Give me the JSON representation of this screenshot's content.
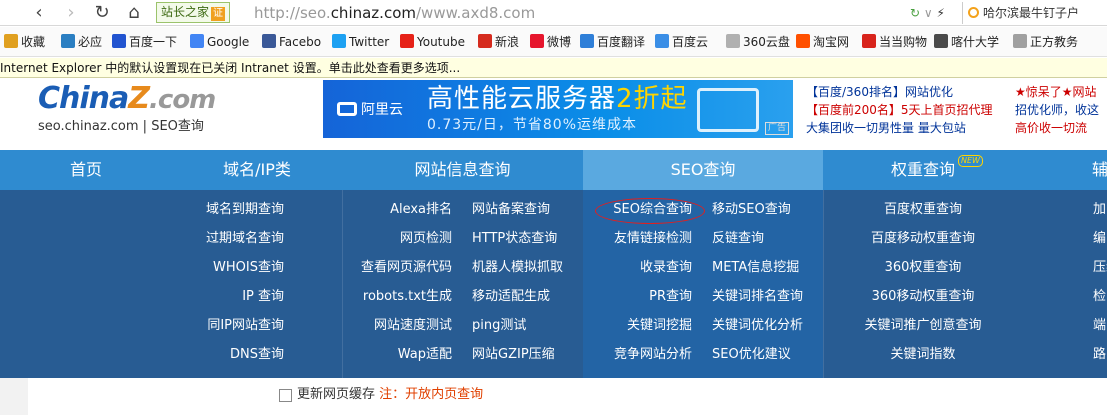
{
  "browser": {
    "site_badge": "站长之家",
    "site_badge_tag": "证",
    "url_prefix": "http://seo.",
    "url_domain": "chinaz.com",
    "url_path": "/www.axd8.com",
    "search_text": "哈尔滨最牛钉子户"
  },
  "bookmarks": [
    {
      "label": "收藏",
      "color": "#e0a020"
    },
    {
      "label": "必应",
      "color": "#2b7fc2"
    },
    {
      "label": "百度一下",
      "color": "#2254d0"
    },
    {
      "label": "Google",
      "color": "#4285f4"
    },
    {
      "label": "Facebo",
      "color": "#3b5998"
    },
    {
      "label": "Twitter",
      "color": "#1da1f2"
    },
    {
      "label": "Youtube",
      "color": "#e62117"
    },
    {
      "label": "新浪",
      "color": "#d52b1e"
    },
    {
      "label": "微博",
      "color": "#e6162d"
    },
    {
      "label": "百度翻译",
      "color": "#2f7fd8"
    },
    {
      "label": "百度云",
      "color": "#3a8ee6"
    },
    {
      "label": "360云盘",
      "color": "#b0b0b0"
    },
    {
      "label": "淘宝网",
      "color": "#ff5000"
    },
    {
      "label": "当当购物",
      "color": "#d8241c"
    },
    {
      "label": "喀什大学",
      "color": "#4a4a4a"
    },
    {
      "label": "正方教务",
      "color": "#a0a0a0"
    }
  ],
  "infobar": "Internet Explorer 中的默认设置现在已关闭 Intranet 设置。单击此处查看更多选项...",
  "logo": {
    "word_a": "Chin",
    "word_b": "a",
    "word_z": "Z",
    "word_c": ".com",
    "sub": "seo.chinaz.com | SEO查询"
  },
  "banner": {
    "brand": "阿里云",
    "title_a": "高性能云服务器",
    "title_hl": "2折起",
    "subtitle": "0.73元/日，节省80%运维成本",
    "ad": "广告"
  },
  "ads": {
    "l1": "【百度/360排名】网站优化",
    "l2": "【百度前200名】5天上首页招代理",
    "l3": "大集团收一切男性量 量大包站",
    "r1": "★惊呆了★网站",
    "r2": "招优化师，收这",
    "r3": "高价收一切流"
  },
  "nav": {
    "home": "首页",
    "domain": "域名/IP类",
    "siteinfo": "网站信息查询",
    "seo": "SEO查询",
    "weight": "权重查询",
    "weight_new": "NEW",
    "more": "辅"
  },
  "dropdown": {
    "domain_col": [
      "域名到期查询",
      "过期域名查询",
      "WHOIS查询",
      "IP 查询",
      "同IP网站查询",
      "DNS查询"
    ],
    "site_left": [
      "Alexa排名",
      "网页检测",
      "查看网页源代码",
      "robots.txt生成",
      "网站速度测试",
      "Wap适配"
    ],
    "site_right": [
      "网站备案查询",
      "HTTP状态查询",
      "机器人模拟抓取",
      "移动适配生成",
      "ping测试",
      "网站GZIP压缩"
    ],
    "seo_left": [
      "SEO综合查询",
      "友情链接检测",
      "收录查询",
      "PR查询",
      "关键词挖掘",
      "竞争网站分析"
    ],
    "seo_right": [
      "移动SEO查询",
      "反链查询",
      "META信息挖掘",
      "关键词排名查询",
      "关键词优化分析",
      "SEO优化建议"
    ],
    "weight_col": [
      "百度权重查询",
      "百度移动权重查询",
      "360权重查询",
      "360移动权重查询",
      "关键词推广创意查询",
      "关键词指数"
    ],
    "edge_col": [
      "加",
      "编",
      "压缩",
      "检",
      "端",
      "路由"
    ]
  },
  "bottom": {
    "checkbox_label": "更新网页缓存",
    "note": "注：开放内页查询"
  }
}
